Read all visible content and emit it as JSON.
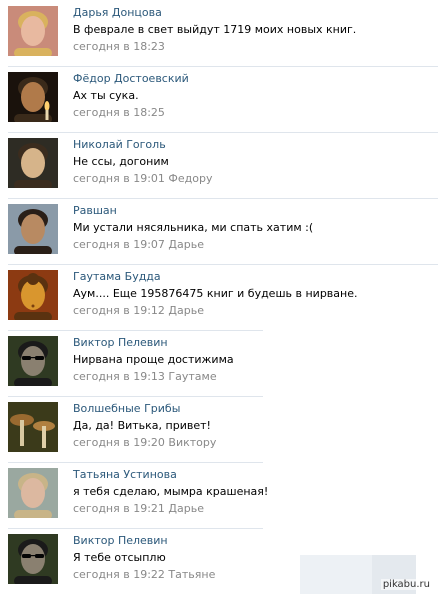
{
  "comments": [
    {
      "author": "Дарья Донцова",
      "text": "В феврале в свет выйдут  1719 моих новых книг.",
      "time": "сегодня в 18:23",
      "reply_to": "",
      "avatar": "woman-blonde",
      "colors": {
        "bg": "#c98b7a",
        "face": "#e8b9a0",
        "hair": "#d9b25e"
      }
    },
    {
      "author": "Фёдор Достоевский",
      "text": "Ах ты сука.",
      "time": "сегодня в 18:25",
      "reply_to": "",
      "avatar": "man-candle",
      "colors": {
        "bg": "#1a120c",
        "face": "#b07a4a",
        "hair": "#3a2a1a"
      }
    },
    {
      "author": "Николай Гоголь",
      "text": "Не ссы, догоним",
      "time": "сегодня в 19:01",
      "reply_to": "Федору",
      "avatar": "man-portrait",
      "colors": {
        "bg": "#2e2c24",
        "face": "#d6b48a",
        "hair": "#3b2c1e"
      }
    },
    {
      "author": "Равшан",
      "text": "Ми устали нясяльника, ми спать хатим :(",
      "time": "сегодня в 19:07",
      "reply_to": "Дарье",
      "avatar": "man-dark-hair",
      "colors": {
        "bg": "#8a9aa8",
        "face": "#b88a62",
        "hair": "#2a1f18"
      }
    },
    {
      "author": "Гаутама Будда",
      "text": "Аум.... Еще 195876475 книг и будешь в нирване.",
      "time": "сегодня в 19:12",
      "reply_to": "Дарье",
      "avatar": "buddha",
      "colors": {
        "bg": "#8c3a12",
        "face": "#d9962e",
        "hair": "#5a3210"
      }
    },
    {
      "author": "Виктор Пелевин",
      "text": "Нирвана проще достижима",
      "time": "сегодня в 19:13",
      "reply_to": "Гаутаме",
      "avatar": "man-sunglasses",
      "colors": {
        "bg": "#2f3a22",
        "face": "#8a8070",
        "hair": "#1a1a1a"
      }
    },
    {
      "author": "Волшебные Грибы",
      "text": "Да, да! Витька, привет!",
      "time": "сегодня в 19:20",
      "reply_to": "Виктору",
      "avatar": "mushrooms",
      "colors": {
        "bg": "#3b3a1a",
        "face": "#c89a5a",
        "hair": "#6a4a22"
      }
    },
    {
      "author": "Татьяна Устинова",
      "text": "я тебя сделаю, мымра крашеная!",
      "time": "сегодня в 19:21",
      "reply_to": "Дарье",
      "avatar": "woman-short-hair",
      "colors": {
        "bg": "#9aa8a0",
        "face": "#dcb8a0",
        "hair": "#c8b488"
      }
    },
    {
      "author": "Виктор Пелевин",
      "text": "Я тебе отсыплю",
      "time": "сегодня в 19:22",
      "reply_to": "Татьяне",
      "avatar": "man-sunglasses",
      "colors": {
        "bg": "#2f3a22",
        "face": "#8a8070",
        "hair": "#1a1a1a"
      }
    }
  ],
  "watermark": "pikabu.ru",
  "colors": {
    "author": "#2b587a",
    "meta": "#888888",
    "text": "#000000",
    "separator": "#dfe5ec"
  }
}
